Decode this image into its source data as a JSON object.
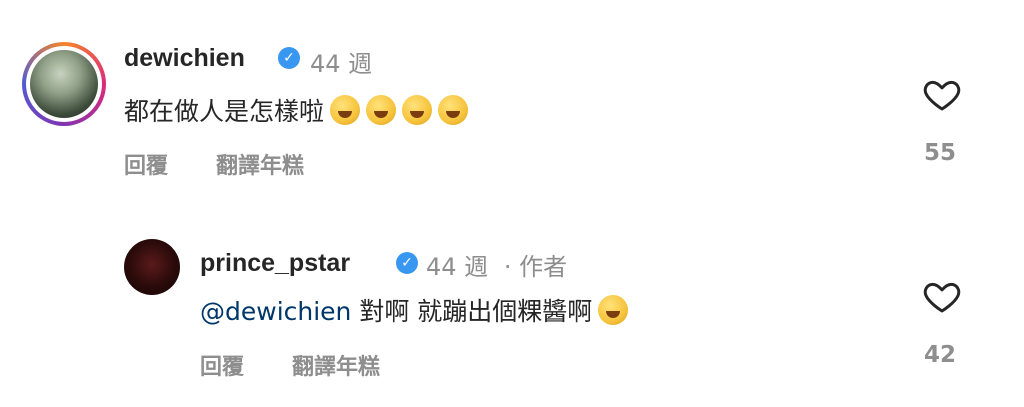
{
  "comments": [
    {
      "username": "dewichien",
      "time": "44 週",
      "author_tag": "",
      "mention": "",
      "text": "都在做人是怎樣啦",
      "reply_label": "回覆",
      "translate_label": "翻譯年糕",
      "likes": "55",
      "emoji_count": 4
    },
    {
      "username": "prince_pstar",
      "time": "44 週",
      "author_tag": "· 作者",
      "mention": "@dewichien",
      "text": "對啊 就蹦出個粿醬啊",
      "reply_label": "回覆",
      "translate_label": "翻譯年糕",
      "likes": "42",
      "emoji_count": 1
    }
  ],
  "colors": {
    "verified": "#3897f0",
    "mention": "#00376b",
    "muted": "#8e8e8e"
  }
}
